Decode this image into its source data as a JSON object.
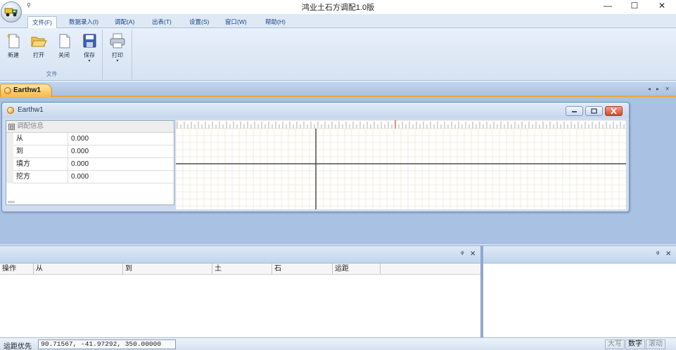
{
  "window": {
    "title": "鸿业土石方调配1.0版",
    "qat_arrow": "⚲",
    "minimize": "—",
    "maximize": "☐",
    "close": "✕"
  },
  "ribbon": {
    "tabs": [
      "文件(F)",
      "数据录入(I)",
      "调配(A)",
      "出表(T)",
      "设置(S)",
      "窗口(W)",
      "帮助(H)"
    ],
    "active_tab": "文件(F)",
    "file_group": {
      "label": "文件",
      "buttons": [
        "新建",
        "打开",
        "关闭",
        "保存"
      ]
    },
    "print_group": {
      "buttons": [
        "打印"
      ]
    },
    "caret": "▾"
  },
  "document": {
    "tab_label": "Earthw1",
    "tab_nav": "◂ ▸ ✕",
    "window_title": "Earthw1",
    "property_grid": {
      "category": "调配信息",
      "collapse_glyph": "⊟",
      "rows": [
        {
          "key": "从",
          "value": "0.000"
        },
        {
          "key": "到",
          "value": "0.000"
        },
        {
          "key": "填方",
          "value": "0.000"
        },
        {
          "key": "挖方",
          "value": "0.000"
        }
      ]
    }
  },
  "bottom_left": {
    "pin": "ᵠ",
    "close": "✕",
    "columns": [
      "操作",
      "从",
      "到",
      "土",
      "石",
      "运距"
    ]
  },
  "bottom_right": {
    "pin": "ᵠ",
    "close": "✕"
  },
  "status": {
    "label": "运距优先",
    "coords": "90.71567, -41.97292, 350.00000",
    "caps": "大写",
    "num": "数字",
    "scroll": "滚动"
  },
  "colors": {
    "accent_tab": "#f7b84a",
    "ribbon_text": "#15428b",
    "doc_background": "#a9c1e2",
    "grid_line": "#efe8d6"
  }
}
